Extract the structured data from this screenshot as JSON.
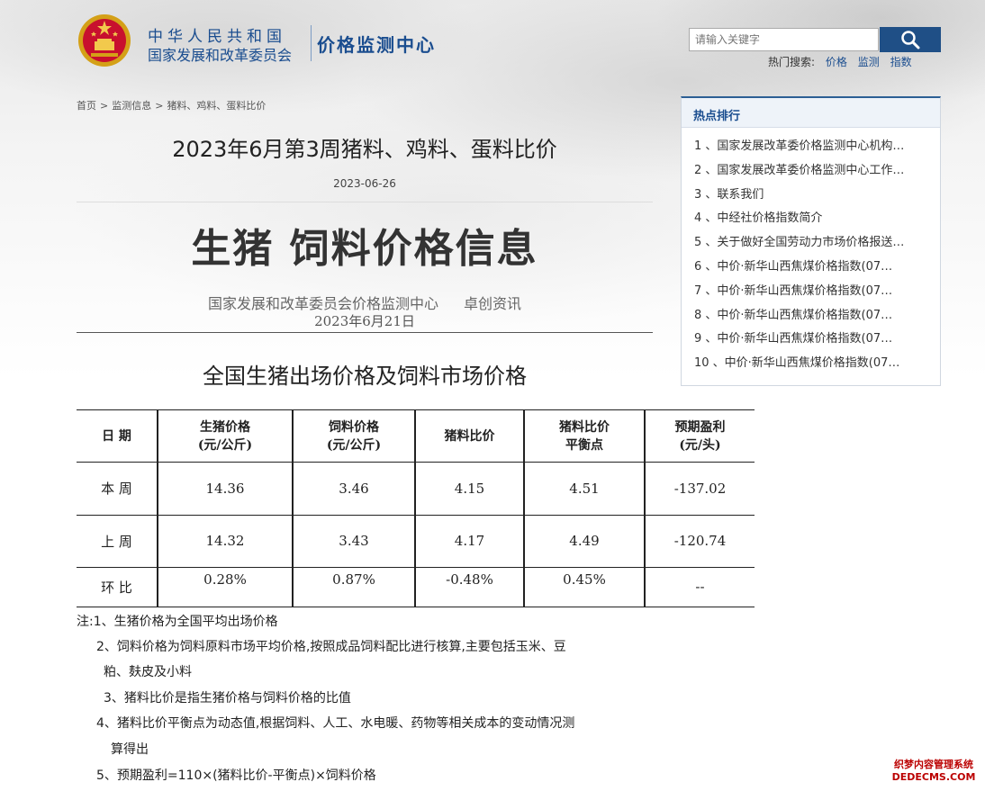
{
  "header": {
    "org_name": "中华人民共和国",
    "org_sub": "国家发展和改革委员会",
    "site_name": "价格监测中心"
  },
  "search": {
    "placeholder": "请输入关键字",
    "hot_label": "热门搜索:",
    "hot_terms": [
      "价格",
      "监测",
      "指数"
    ]
  },
  "breadcrumb": [
    "首页",
    "监测信息",
    "猪料、鸡料、蛋料比价"
  ],
  "article": {
    "title": "2023年6月第3周猪料、鸡料、蛋料比价",
    "date": "2023-06-26",
    "big_title": "生猪  饲料价格信息",
    "source_1": "国家发展和改革委员会价格监测中心",
    "source_2": "卓创资讯",
    "pub_date": "2023年6月21日",
    "table_title": "全国生猪出场价格及饲料市场价格"
  },
  "table": {
    "headers": [
      {
        "l1": "日  期",
        "l2": ""
      },
      {
        "l1": "生猪价格",
        "l2": "(元/公斤)"
      },
      {
        "l1": "饲料价格",
        "l2": "(元/公斤)"
      },
      {
        "l1": "猪料比价",
        "l2": ""
      },
      {
        "l1": "猪料比价",
        "l2": "平衡点"
      },
      {
        "l1": "预期盈利",
        "l2": "(元/头)"
      }
    ],
    "rows": [
      [
        "本  周",
        "14.36",
        "3.46",
        "4.15",
        "4.51",
        "-137.02"
      ],
      [
        "上  周",
        "14.32",
        "3.43",
        "4.17",
        "4.49",
        "-120.74"
      ],
      [
        "环  比",
        "0.28%",
        "0.87%",
        "-0.48%",
        "0.45%",
        "--"
      ]
    ]
  },
  "notes": {
    "n1": "注:1、生猪价格为全国平均出场价格",
    "n2a": "2、饲料价格为饲料原料市场平均价格,按照成品饲料配比进行核算,主要包括玉米、豆",
    "n2b": "粕、麸皮及小料",
    "n3": "3、猪料比价是指生猪价格与饲料价格的比值",
    "n4a": "4、猪料比价平衡点为动态值,根据饲料、人工、水电暖、药物等相关成本的变动情况测",
    "n4b": "算得出",
    "n5": "5、预期盈利=110×(猪料比价-平衡点)×饲料价格"
  },
  "sidebar": {
    "title": "热点排行",
    "items": [
      "1 、国家发展改革委价格监测中心机构…",
      "2 、国家发展改革委价格监测中心工作…",
      "3 、联系我们",
      "4 、中经社价格指数简介",
      "5 、关于做好全国劳动力市场价格报送…",
      "6 、中价·新华山西焦煤价格指数(07…",
      "7 、中价·新华山西焦煤价格指数(07…",
      "8 、中价·新华山西焦煤价格指数(07…",
      "9 、中价·新华山西焦煤价格指数(07…",
      "10 、中价·新华山西焦煤价格指数(07…"
    ]
  },
  "watermark": {
    "line1": "织梦内容管理系统",
    "line2": "DEDECMS.COM"
  },
  "icons": {
    "emblem": "national-emblem-icon",
    "search": "search-icon"
  }
}
